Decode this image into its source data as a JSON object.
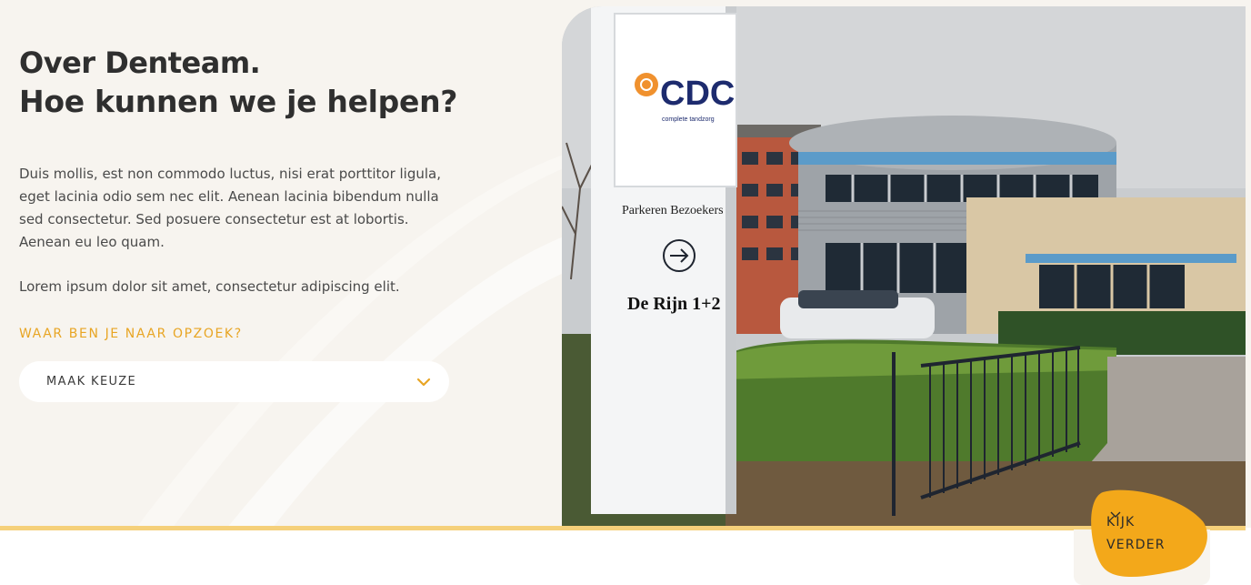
{
  "heading": {
    "title_bold": "Over Denteam.",
    "title_light": "Hoe kunnen we je helpen?"
  },
  "body": {
    "paragraph_1": "Duis mollis, est non commodo luctus, nisi erat porttitor ligula, eget lacinia odio sem nec elit. Aenean lacinia bibendum nulla sed consectetur. Sed posuere consectetur est at lobortis. Aenean eu leo quam.",
    "paragraph_2": "Lorem ipsum dolor sit amet, consectetur adipiscing elit."
  },
  "search": {
    "prompt": "WAAR BEN JE NAAR OPZOEK?",
    "select_value": "MAAK KEUZE",
    "chevron_icon": "chevron-down-icon"
  },
  "photo": {
    "sign_brand": "CDC",
    "sign_tagline": "complete tandzorg",
    "sign_parking": "Parkeren Bezoekers",
    "sign_address": "De Rijn 1+2",
    "arrow_icon": "arrow-right-icon"
  },
  "scroll_cta": {
    "line_1": "KIJK",
    "line_2": "VERDER",
    "icon": "chevron-down-icon"
  },
  "colors": {
    "accent": "#e8a524",
    "blob": "#f3a81a",
    "background": "#f7f4ef",
    "gold_line": "#f5d07a",
    "text": "#2f2f2f"
  }
}
